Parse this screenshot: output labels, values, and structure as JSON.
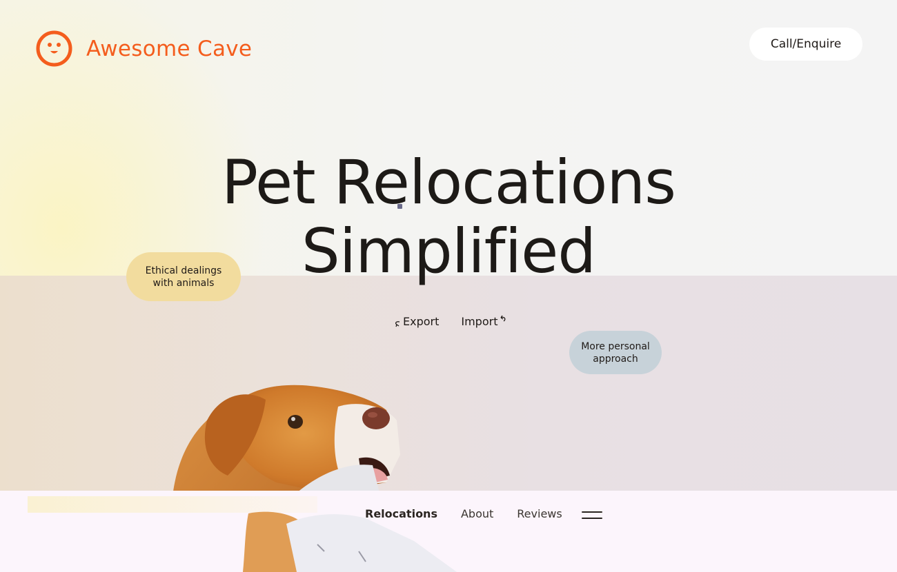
{
  "brand": {
    "name": "Awesome Cave",
    "logo_icon": "smiley-face-icon",
    "accent": "#f45d1d"
  },
  "header": {
    "cta_label": "Call/Enquire"
  },
  "hero": {
    "headline_line1": "Pet Relocations",
    "headline_line2": "Simplified",
    "badges": {
      "ethical": "Ethical dealings with animals",
      "personal": "More personal approach"
    },
    "actions": {
      "export": "Export",
      "import": "Import"
    }
  },
  "nav": {
    "items": [
      {
        "label": "Relocations",
        "active": true
      },
      {
        "label": "About",
        "active": false
      },
      {
        "label": "Reviews",
        "active": false
      }
    ],
    "menu_icon": "hamburger-menu-icon"
  }
}
